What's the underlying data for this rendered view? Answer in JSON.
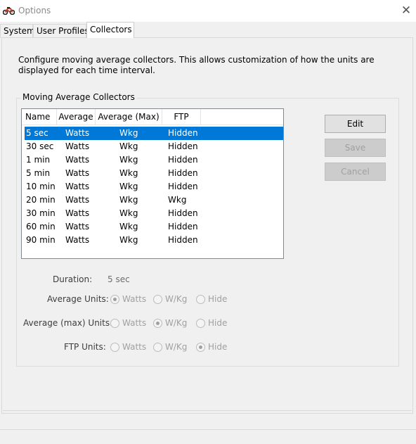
{
  "window": {
    "title": "Options",
    "close_glyph": "✕",
    "icon": "motorcycle-icon"
  },
  "tabs": [
    {
      "label": "System",
      "active": false
    },
    {
      "label": "User Profiles",
      "active": false
    },
    {
      "label": "Collectors",
      "active": true
    }
  ],
  "description": "Configure moving average collectors.  This allows customization of how the units are displayed for each time interval.",
  "group": {
    "label": "Moving Average Collectors",
    "columns": [
      "Name",
      "Average",
      "Average (Max)",
      "FTP"
    ],
    "rows": [
      {
        "name": "5 sec",
        "average": "Watts",
        "average_max": "Wkg",
        "ftp": "Hidden",
        "selected": true
      },
      {
        "name": "30 sec",
        "average": "Watts",
        "average_max": "Wkg",
        "ftp": "Hidden"
      },
      {
        "name": "1 min",
        "average": "Watts",
        "average_max": "Wkg",
        "ftp": "Hidden"
      },
      {
        "name": "5 min",
        "average": "Watts",
        "average_max": "Wkg",
        "ftp": "Hidden"
      },
      {
        "name": "10 min",
        "average": "Watts",
        "average_max": "Wkg",
        "ftp": "Hidden"
      },
      {
        "name": "20 min",
        "average": "Watts",
        "average_max": "Wkg",
        "ftp": "Wkg"
      },
      {
        "name": "30 min",
        "average": "Watts",
        "average_max": "Wkg",
        "ftp": "Hidden"
      },
      {
        "name": "60 min",
        "average": "Watts",
        "average_max": "Wkg",
        "ftp": "Hidden"
      },
      {
        "name": "90 min",
        "average": "Watts",
        "average_max": "Wkg",
        "ftp": "Hidden"
      }
    ]
  },
  "buttons": {
    "edit": "Edit",
    "save": "Save",
    "cancel": "Cancel"
  },
  "form": {
    "duration_label": "Duration:",
    "duration_value": "5 sec",
    "average_units_label": "Average Units:",
    "average_max_units_label": "Average (max) Units:",
    "ftp_units_label": "FTP Units:",
    "options": {
      "watts": "Watts",
      "wkg": "W/Kg",
      "hide": "Hide"
    },
    "average_units_selected": "Watts",
    "average_max_units_selected": "W/Kg",
    "ftp_units_selected": "Hide"
  },
  "colors": {
    "selection": "#0078d7",
    "accent_text": "#ffffff"
  }
}
